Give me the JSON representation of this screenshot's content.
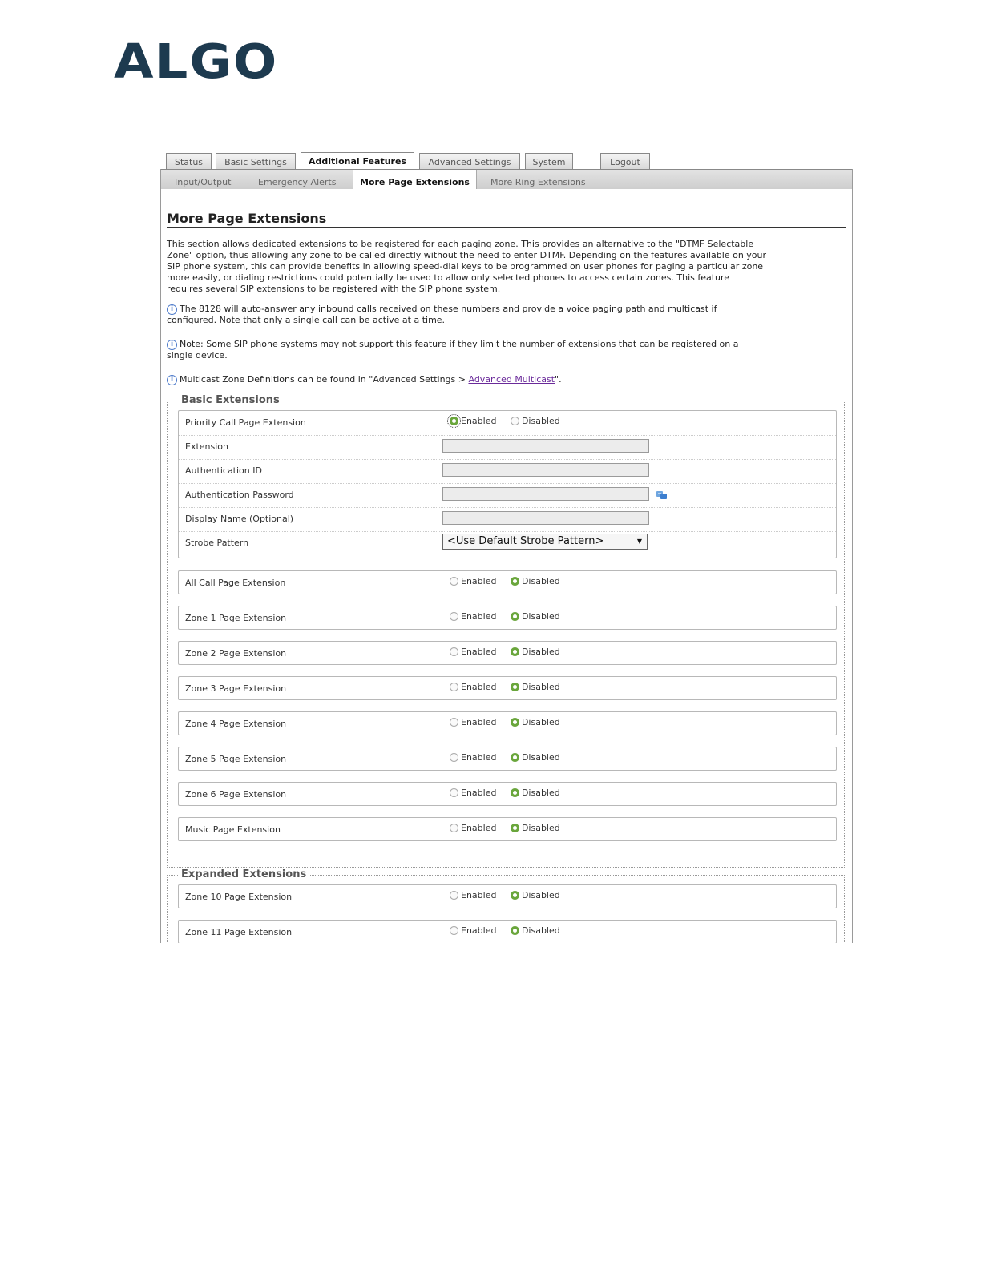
{
  "brand": {
    "logo_text": "ALGO"
  },
  "tabs": {
    "status": "Status",
    "basic_settings": "Basic Settings",
    "additional_features": "Additional Features",
    "advanced_settings": "Advanced Settings",
    "system": "System",
    "logout": "Logout"
  },
  "subtabs": {
    "input_output": "Input/Output",
    "emergency_alerts": "Emergency Alerts",
    "more_page_extensions": "More Page Extensions",
    "more_ring_extensions": "More Ring Extensions"
  },
  "page": {
    "title": "More Page Extensions",
    "intro_1": "This section allows dedicated extensions to be registered for each paging zone. This provides an alternative to the \"DTMF Selectable",
    "intro_2": "Zone\" option, thus allowing any zone to be called directly without the need to enter DTMF. Depending on the features available on your",
    "intro_3": "SIP phone system, this can provide benefits in allowing speed-dial keys to be programmed on user phones for paging a particular zone",
    "intro_4": "more easily, or dialing restrictions could potentially be used to allow only selected phones to access certain zones. This feature",
    "intro_5": "requires several SIP extensions to be registered with the SIP phone system.",
    "info1_line1": "The 8128 will auto-answer any inbound calls received on these numbers and provide a voice paging path and multicast if",
    "info1_line2": "configured. Note that only a single call can be active at a time.",
    "info2_line1": "Note: Some SIP phone systems may not support this feature if they limit the number of extensions that can be registered on a",
    "info2_line2": "single device.",
    "info3_prefix": "Multicast Zone Definitions can be found in \"Advanced Settings > ",
    "info3_link": "Advanced Multicast",
    "info3_suffix": "\"."
  },
  "radio_labels": {
    "enabled": "Enabled",
    "disabled": "Disabled"
  },
  "basic": {
    "legend": "Basic Extensions",
    "priority": {
      "label": "Priority Call Page Extension",
      "state": "Enabled",
      "extension_label": "Extension",
      "extension_value": "",
      "auth_id_label": "Authentication ID",
      "auth_id_value": "",
      "auth_pw_label": "Authentication Password",
      "auth_pw_value": "",
      "display_name_label": "Display Name (Optional)",
      "display_name_value": "",
      "strobe_label": "Strobe Pattern",
      "strobe_value": "<Use Default Strobe Pattern>"
    },
    "all_call": {
      "label": "All Call Page Extension",
      "state": "Disabled"
    },
    "zone1": {
      "label": "Zone 1 Page Extension",
      "state": "Disabled"
    },
    "zone2": {
      "label": "Zone 2 Page Extension",
      "state": "Disabled"
    },
    "zone3": {
      "label": "Zone 3 Page Extension",
      "state": "Disabled"
    },
    "zone4": {
      "label": "Zone 4 Page Extension",
      "state": "Disabled"
    },
    "zone5": {
      "label": "Zone 5 Page Extension",
      "state": "Disabled"
    },
    "zone6": {
      "label": "Zone 6 Page Extension",
      "state": "Disabled"
    },
    "music": {
      "label": "Music Page Extension",
      "state": "Disabled"
    }
  },
  "expanded": {
    "legend": "Expanded Extensions",
    "zone10": {
      "label": "Zone 10 Page Extension",
      "state": "Disabled"
    },
    "zone11": {
      "label": "Zone 11 Page Extension",
      "state": "Disabled"
    }
  },
  "colors": {
    "logo": "#1d3a4f",
    "radio_selected": "#6aa63c",
    "link": "#6a2a9a"
  }
}
